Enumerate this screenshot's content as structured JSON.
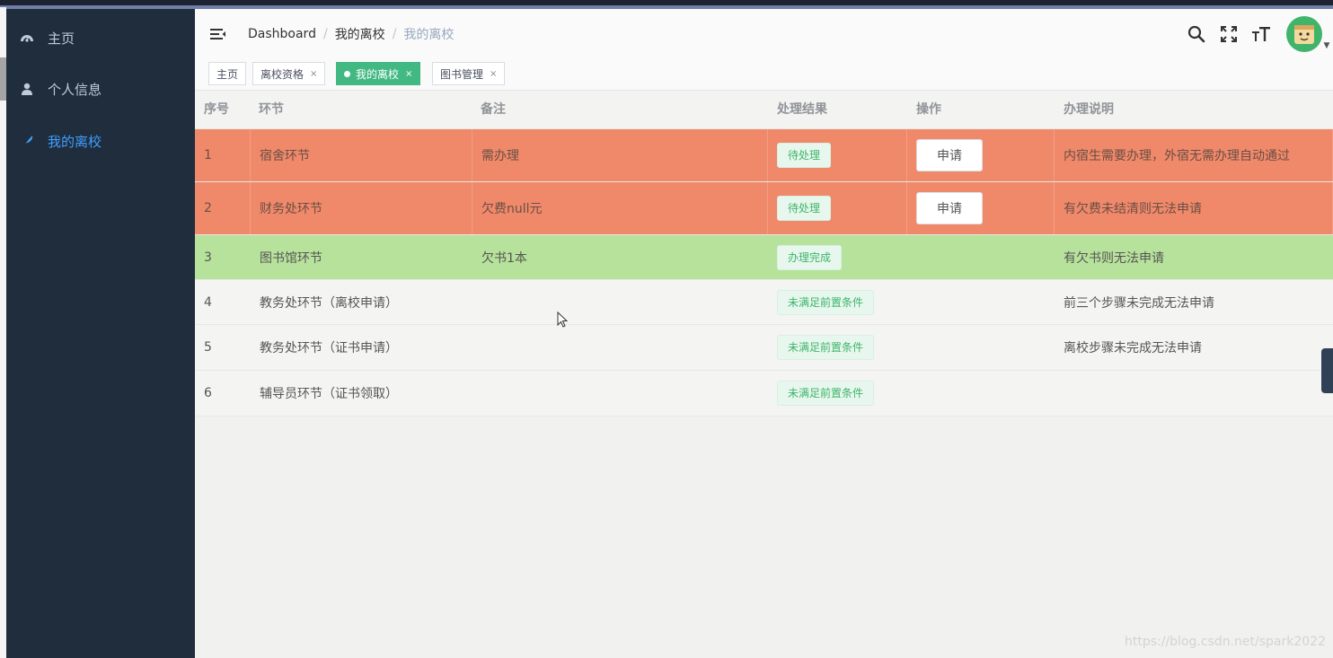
{
  "sidebar": {
    "items": [
      {
        "label": "主页",
        "icon": "dashboard-icon",
        "active": false
      },
      {
        "label": "个人信息",
        "icon": "user-icon",
        "active": false
      },
      {
        "label": "我的离校",
        "icon": "feather-icon",
        "active": true
      }
    ]
  },
  "navbar": {
    "breadcrumb": [
      "Dashboard",
      "我的离校",
      "我的离校"
    ],
    "icons": [
      "search-icon",
      "fullscreen-icon",
      "font-size-icon",
      "avatar"
    ]
  },
  "tags": [
    {
      "label": "主页",
      "active": false,
      "closable": false
    },
    {
      "label": "离校资格",
      "active": false,
      "closable": true
    },
    {
      "label": "我的离校",
      "active": true,
      "closable": true
    },
    {
      "label": "图书管理",
      "active": false,
      "closable": true
    }
  ],
  "table": {
    "headers": [
      "序号",
      "环节",
      "备注",
      "处理结果",
      "操作",
      "办理说明"
    ],
    "rows": [
      {
        "no": "1",
        "step": "宿舍环节",
        "note": "需办理",
        "result": "待处理",
        "action": "申请",
        "desc": "内宿生需要办理，外宿无需办理自动通过",
        "status": "red"
      },
      {
        "no": "2",
        "step": "财务处环节",
        "note": "欠费null元",
        "result": "待处理",
        "action": "申请",
        "desc": "有欠费未结清则无法申请",
        "status": "red"
      },
      {
        "no": "3",
        "step": "图书馆环节",
        "note": "欠书1本",
        "result": "办理完成",
        "action": "",
        "desc": "有欠书则无法申请",
        "status": "green"
      },
      {
        "no": "4",
        "step": "教务处环节（离校申请）",
        "note": "",
        "result": "未满足前置条件",
        "action": "",
        "desc": "前三个步骤未完成无法申请",
        "status": "plain"
      },
      {
        "no": "5",
        "step": "教务处环节（证书申请）",
        "note": "",
        "result": "未满足前置条件",
        "action": "",
        "desc": "离校步骤未完成无法申请",
        "status": "plain"
      },
      {
        "no": "6",
        "step": "辅导员环节（证书领取）",
        "note": "",
        "result": "未满足前置条件",
        "action": "",
        "desc": "",
        "status": "plain"
      }
    ]
  },
  "watermark": "https://blog.csdn.net/spark2022",
  "colors": {
    "sidebar_bg": "#1f2d3d",
    "active_menu": "#409eff",
    "active_tag": "#42b983",
    "pending_row": "#f0896a",
    "done_row": "#b7e29b"
  }
}
